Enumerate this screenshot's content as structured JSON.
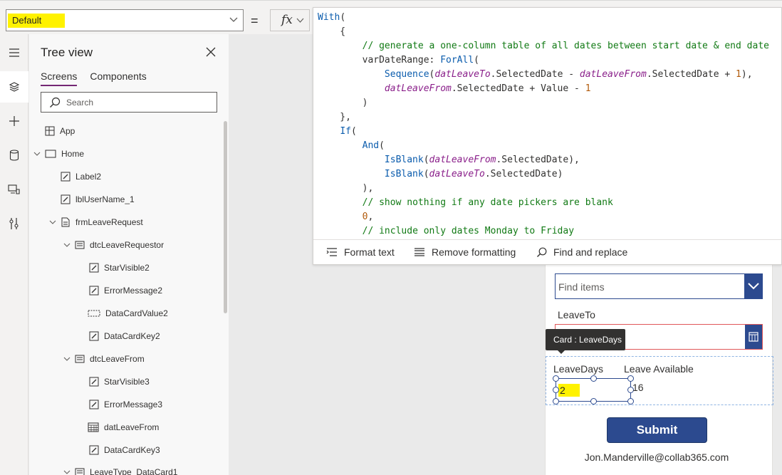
{
  "formula_bar": {
    "property": "Default",
    "fx_label": "fx",
    "equals": "="
  },
  "tree": {
    "title": "Tree view",
    "tabs": [
      "Screens",
      "Components"
    ],
    "search_placeholder": "Search",
    "nodes": [
      {
        "label": "App",
        "icon": "app-icon"
      },
      {
        "label": "Home",
        "icon": "screen-icon"
      },
      {
        "label": "Label2",
        "icon": "label-icon"
      },
      {
        "label": "lblUserName_1",
        "icon": "label-icon"
      },
      {
        "label": "frmLeaveRequest",
        "icon": "form-icon"
      },
      {
        "label": "dtcLeaveRequestor",
        "icon": "card-icon"
      },
      {
        "label": "StarVisible2",
        "icon": "label-icon"
      },
      {
        "label": "ErrorMessage2",
        "icon": "label-icon"
      },
      {
        "label": "DataCardValue2",
        "icon": "textinput-icon"
      },
      {
        "label": "DataCardKey2",
        "icon": "label-icon"
      },
      {
        "label": "dtcLeaveFrom",
        "icon": "card-icon"
      },
      {
        "label": "StarVisible3",
        "icon": "label-icon"
      },
      {
        "label": "ErrorMessage3",
        "icon": "label-icon"
      },
      {
        "label": "datLeaveFrom",
        "icon": "calendar-icon"
      },
      {
        "label": "DataCardKey3",
        "icon": "label-icon"
      },
      {
        "label": "LeaveType_DataCard1",
        "icon": "card-icon"
      }
    ]
  },
  "editor": {
    "footer": {
      "format_text": "Format text",
      "remove_formatting": "Remove formatting",
      "find_replace": "Find and replace"
    }
  },
  "canvas": {
    "dropdown_placeholder": "Find items",
    "leave_to_label": "LeaveTo",
    "tooltip": "Card : LeaveDays",
    "leave_days_label": "LeaveDays",
    "leave_available_label": "Leave Available",
    "leave_days_value": "2",
    "leave_available_value": "16",
    "submit_label": "Submit",
    "user_email": "Jon.Manderville@collab365.com"
  },
  "colors": {
    "accent": "#2c4a8f",
    "highlight": "#fff200",
    "tab_underline": "#742774",
    "error_border": "#e15759"
  }
}
